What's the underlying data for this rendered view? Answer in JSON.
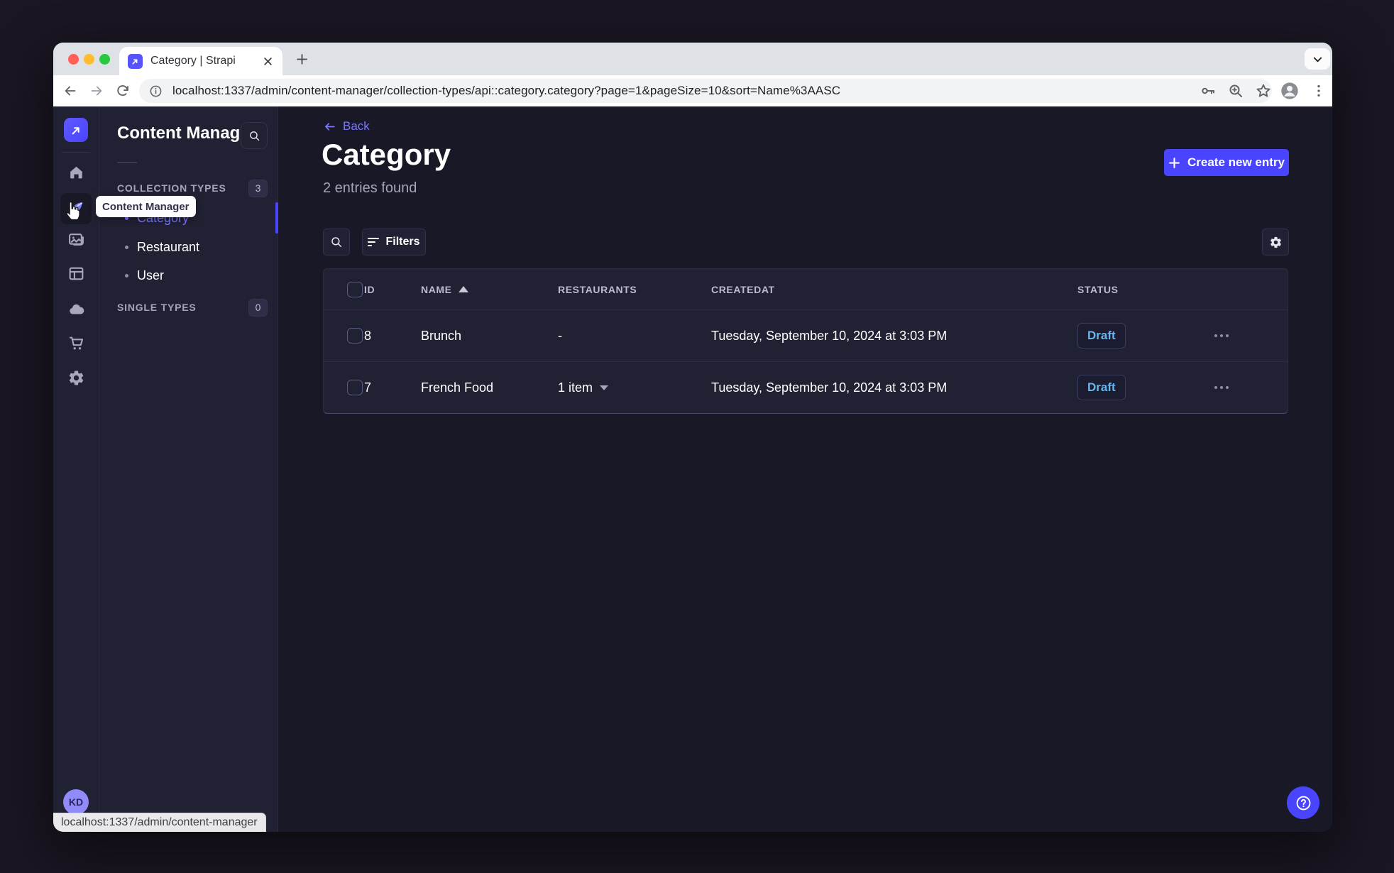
{
  "window": {
    "tab_title": "Category | Strapi",
    "url": "localhost:1337/admin/content-manager/collection-types/api::category.category?page=1&pageSize=10&sort=Name%3AASC",
    "status_text": "localhost:1337/admin/content-manager"
  },
  "nav": {
    "tooltip": "Content Manager",
    "avatar": "KD",
    "items": [
      "home",
      "content-manager",
      "media-library",
      "content-type-builder",
      "deploy",
      "marketplace",
      "settings"
    ]
  },
  "subnav": {
    "title": "Content Manager",
    "sections": [
      {
        "label": "COLLECTION TYPES",
        "count": "3",
        "items": [
          {
            "label": "Category",
            "active": true
          },
          {
            "label": "Restaurant",
            "active": false
          },
          {
            "label": "User",
            "active": false
          }
        ]
      },
      {
        "label": "SINGLE TYPES",
        "count": "0",
        "items": []
      }
    ]
  },
  "main": {
    "back_label": "Back",
    "title": "Category",
    "subtitle": "2 entries found",
    "create_label": "Create new entry",
    "filters_label": "Filters",
    "table": {
      "headers": [
        "ID",
        "NAME",
        "RESTAURANTS",
        "CREATEDAT",
        "STATUS"
      ],
      "sorted_by": "NAME",
      "sort_direction": "ASC",
      "rows": [
        {
          "id": "8",
          "name": "Brunch",
          "restaurants": "-",
          "created": "Tuesday, September 10, 2024 at 3:03 PM",
          "status": "Draft"
        },
        {
          "id": "7",
          "name": "French Food",
          "restaurants": "1 item",
          "created": "Tuesday, September 10, 2024 at 3:03 PM",
          "status": "Draft"
        }
      ]
    }
  },
  "icons": {
    "strapi-logo": "arrow-up-right in purple rounded square",
    "search-icon": "magnifier",
    "filter-icon": "three stacked lines",
    "gear-icon": "cog",
    "more-icon": "horizontal ellipsis",
    "help-icon": "circled question mark",
    "cursor": "pointing hand"
  },
  "colors": {
    "accent": "#4945ff",
    "accent_light": "#7b79ff",
    "draft_text": "#66b7f1",
    "panel_bg": "#212134",
    "app_bg": "#181826",
    "muted_text": "#a5a5ba"
  }
}
